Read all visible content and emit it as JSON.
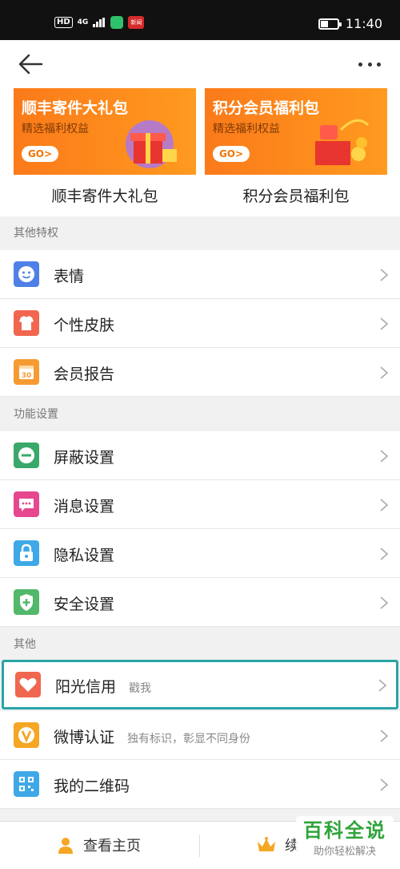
{
  "status": {
    "hd": "HD",
    "network": "4G",
    "time": "11:40",
    "app2_text": "新闻"
  },
  "nav": {
    "back_icon": "arrow-left-icon",
    "more_icon": "more-dots-icon"
  },
  "banners": [
    {
      "title": "顺丰寄件大礼包",
      "subtitle": "精选福利权益",
      "go": "GO>",
      "caption": "顺丰寄件大礼包"
    },
    {
      "title": "积分会员福利包",
      "subtitle": "精选福利权益",
      "go": "GO>",
      "caption": "积分会员福利包"
    }
  ],
  "sections": [
    {
      "header": "其他特权",
      "items": [
        {
          "label": "表情",
          "icon": "emoji-icon",
          "color": "#4f80e6"
        },
        {
          "label": "个性皮肤",
          "icon": "tshirt-icon",
          "color": "#f0664f"
        },
        {
          "label": "会员报告",
          "icon": "calendar-icon",
          "color": "#f59b32"
        }
      ]
    },
    {
      "header": "功能设置",
      "items": [
        {
          "label": "屏蔽设置",
          "icon": "block-icon",
          "color": "#3aa86a"
        },
        {
          "label": "消息设置",
          "icon": "message-icon",
          "color": "#e6478f"
        },
        {
          "label": "隐私设置",
          "icon": "lock-icon",
          "color": "#3fa8e6"
        },
        {
          "label": "安全设置",
          "icon": "shield-icon",
          "color": "#52b86a"
        }
      ]
    },
    {
      "header": "其他",
      "items": [
        {
          "label": "阳光信用",
          "sub": "戳我",
          "icon": "heart-icon",
          "color": "#f0664f"
        },
        {
          "label": "微博认证",
          "sub": "独有标识，彰显不同身份",
          "icon": "verified-icon",
          "color": "#f5a623"
        },
        {
          "label": "我的二维码",
          "icon": "qrcode-icon",
          "color": "#3fa8e6"
        }
      ]
    }
  ],
  "bottom": {
    "tab1": "查看主页",
    "tab2": "续"
  },
  "watermark": {
    "line1": "百科全说",
    "line2": "助你轻松解决"
  }
}
